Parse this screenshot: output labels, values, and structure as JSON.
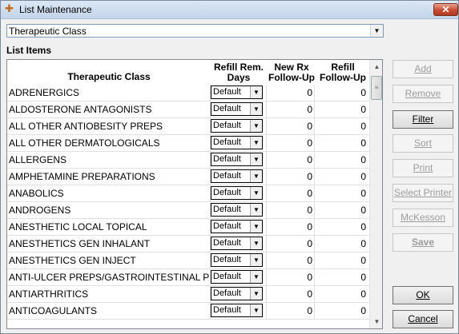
{
  "window": {
    "title": "List Maintenance",
    "close_label": "✕"
  },
  "list_select": {
    "value": "Therapeutic Class"
  },
  "list_items_label": "List Items",
  "columns": {
    "name": "Therapeutic Class",
    "refill_days": "Refill Rem. Days",
    "new_rx": "New Rx Follow-Up",
    "refill_followup": "Refill Follow-Up"
  },
  "rows": [
    {
      "name": "ADRENERGICS",
      "refill_days": "Default",
      "new_rx": "0",
      "refill_followup": "0"
    },
    {
      "name": "ALDOSTERONE ANTAGONISTS",
      "refill_days": "Default",
      "new_rx": "0",
      "refill_followup": "0"
    },
    {
      "name": "ALL OTHER ANTIOBESITY PREPS",
      "refill_days": "Default",
      "new_rx": "0",
      "refill_followup": "0"
    },
    {
      "name": "ALL OTHER DERMATOLOGICALS",
      "refill_days": "Default",
      "new_rx": "0",
      "refill_followup": "0"
    },
    {
      "name": "ALLERGENS",
      "refill_days": "Default",
      "new_rx": "0",
      "refill_followup": "0"
    },
    {
      "name": "AMPHETAMINE PREPARATIONS",
      "refill_days": "Default",
      "new_rx": "0",
      "refill_followup": "0"
    },
    {
      "name": "ANABOLICS",
      "refill_days": "Default",
      "new_rx": "0",
      "refill_followup": "0"
    },
    {
      "name": "ANDROGENS",
      "refill_days": "Default",
      "new_rx": "0",
      "refill_followup": "0"
    },
    {
      "name": "ANESTHETIC LOCAL TOPICAL",
      "refill_days": "Default",
      "new_rx": "0",
      "refill_followup": "0"
    },
    {
      "name": "ANESTHETICS GEN INHALANT",
      "refill_days": "Default",
      "new_rx": "0",
      "refill_followup": "0"
    },
    {
      "name": "ANESTHETICS GEN INJECT",
      "refill_days": "Default",
      "new_rx": "0",
      "refill_followup": "0"
    },
    {
      "name": "ANTI-ULCER PREPS/GASTROINTESTINAL PREPS",
      "refill_days": "Default",
      "new_rx": "0",
      "refill_followup": "0"
    },
    {
      "name": "ANTIARTHRITICS",
      "refill_days": "Default",
      "new_rx": "0",
      "refill_followup": "0"
    },
    {
      "name": "ANTICOAGULANTS",
      "refill_days": "Default",
      "new_rx": "0",
      "refill_followup": "0"
    }
  ],
  "buttons": {
    "add": "Add",
    "remove": "Remove",
    "filter": "Filter",
    "sort": "Sort",
    "print": "Print",
    "select_printer": "Select Printer",
    "mckesson": "McKesson",
    "save": "Save",
    "ok": "OK",
    "cancel": "Cancel"
  }
}
